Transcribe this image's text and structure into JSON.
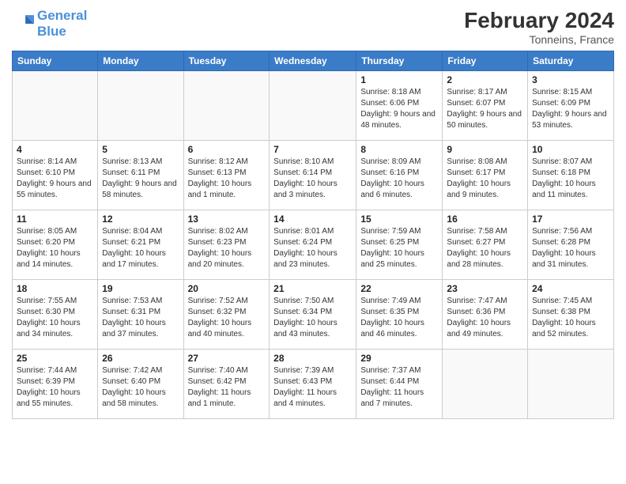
{
  "header": {
    "logo_line1": "General",
    "logo_line2": "Blue",
    "month_title": "February 2024",
    "location": "Tonneins, France"
  },
  "weekdays": [
    "Sunday",
    "Monday",
    "Tuesday",
    "Wednesday",
    "Thursday",
    "Friday",
    "Saturday"
  ],
  "weeks": [
    [
      {
        "day": "",
        "info": ""
      },
      {
        "day": "",
        "info": ""
      },
      {
        "day": "",
        "info": ""
      },
      {
        "day": "",
        "info": ""
      },
      {
        "day": "1",
        "info": "Sunrise: 8:18 AM\nSunset: 6:06 PM\nDaylight: 9 hours and 48 minutes."
      },
      {
        "day": "2",
        "info": "Sunrise: 8:17 AM\nSunset: 6:07 PM\nDaylight: 9 hours and 50 minutes."
      },
      {
        "day": "3",
        "info": "Sunrise: 8:15 AM\nSunset: 6:09 PM\nDaylight: 9 hours and 53 minutes."
      }
    ],
    [
      {
        "day": "4",
        "info": "Sunrise: 8:14 AM\nSunset: 6:10 PM\nDaylight: 9 hours and 55 minutes."
      },
      {
        "day": "5",
        "info": "Sunrise: 8:13 AM\nSunset: 6:11 PM\nDaylight: 9 hours and 58 minutes."
      },
      {
        "day": "6",
        "info": "Sunrise: 8:12 AM\nSunset: 6:13 PM\nDaylight: 10 hours and 1 minute."
      },
      {
        "day": "7",
        "info": "Sunrise: 8:10 AM\nSunset: 6:14 PM\nDaylight: 10 hours and 3 minutes."
      },
      {
        "day": "8",
        "info": "Sunrise: 8:09 AM\nSunset: 6:16 PM\nDaylight: 10 hours and 6 minutes."
      },
      {
        "day": "9",
        "info": "Sunrise: 8:08 AM\nSunset: 6:17 PM\nDaylight: 10 hours and 9 minutes."
      },
      {
        "day": "10",
        "info": "Sunrise: 8:07 AM\nSunset: 6:18 PM\nDaylight: 10 hours and 11 minutes."
      }
    ],
    [
      {
        "day": "11",
        "info": "Sunrise: 8:05 AM\nSunset: 6:20 PM\nDaylight: 10 hours and 14 minutes."
      },
      {
        "day": "12",
        "info": "Sunrise: 8:04 AM\nSunset: 6:21 PM\nDaylight: 10 hours and 17 minutes."
      },
      {
        "day": "13",
        "info": "Sunrise: 8:02 AM\nSunset: 6:23 PM\nDaylight: 10 hours and 20 minutes."
      },
      {
        "day": "14",
        "info": "Sunrise: 8:01 AM\nSunset: 6:24 PM\nDaylight: 10 hours and 23 minutes."
      },
      {
        "day": "15",
        "info": "Sunrise: 7:59 AM\nSunset: 6:25 PM\nDaylight: 10 hours and 25 minutes."
      },
      {
        "day": "16",
        "info": "Sunrise: 7:58 AM\nSunset: 6:27 PM\nDaylight: 10 hours and 28 minutes."
      },
      {
        "day": "17",
        "info": "Sunrise: 7:56 AM\nSunset: 6:28 PM\nDaylight: 10 hours and 31 minutes."
      }
    ],
    [
      {
        "day": "18",
        "info": "Sunrise: 7:55 AM\nSunset: 6:30 PM\nDaylight: 10 hours and 34 minutes."
      },
      {
        "day": "19",
        "info": "Sunrise: 7:53 AM\nSunset: 6:31 PM\nDaylight: 10 hours and 37 minutes."
      },
      {
        "day": "20",
        "info": "Sunrise: 7:52 AM\nSunset: 6:32 PM\nDaylight: 10 hours and 40 minutes."
      },
      {
        "day": "21",
        "info": "Sunrise: 7:50 AM\nSunset: 6:34 PM\nDaylight: 10 hours and 43 minutes."
      },
      {
        "day": "22",
        "info": "Sunrise: 7:49 AM\nSunset: 6:35 PM\nDaylight: 10 hours and 46 minutes."
      },
      {
        "day": "23",
        "info": "Sunrise: 7:47 AM\nSunset: 6:36 PM\nDaylight: 10 hours and 49 minutes."
      },
      {
        "day": "24",
        "info": "Sunrise: 7:45 AM\nSunset: 6:38 PM\nDaylight: 10 hours and 52 minutes."
      }
    ],
    [
      {
        "day": "25",
        "info": "Sunrise: 7:44 AM\nSunset: 6:39 PM\nDaylight: 10 hours and 55 minutes."
      },
      {
        "day": "26",
        "info": "Sunrise: 7:42 AM\nSunset: 6:40 PM\nDaylight: 10 hours and 58 minutes."
      },
      {
        "day": "27",
        "info": "Sunrise: 7:40 AM\nSunset: 6:42 PM\nDaylight: 11 hours and 1 minute."
      },
      {
        "day": "28",
        "info": "Sunrise: 7:39 AM\nSunset: 6:43 PM\nDaylight: 11 hours and 4 minutes."
      },
      {
        "day": "29",
        "info": "Sunrise: 7:37 AM\nSunset: 6:44 PM\nDaylight: 11 hours and 7 minutes."
      },
      {
        "day": "",
        "info": ""
      },
      {
        "day": "",
        "info": ""
      }
    ]
  ]
}
